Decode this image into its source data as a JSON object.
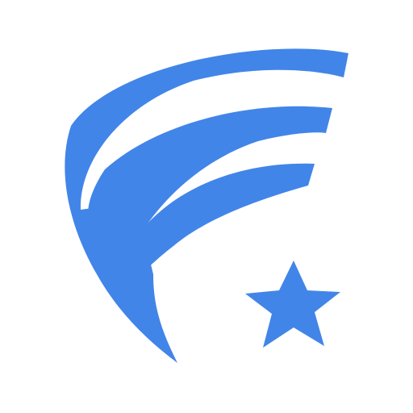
{
  "logo": {
    "name": "shooting-star-logo",
    "icon": "shooting-star-icon",
    "primary_color": "#4285e8",
    "background_color": "#ffffff"
  }
}
